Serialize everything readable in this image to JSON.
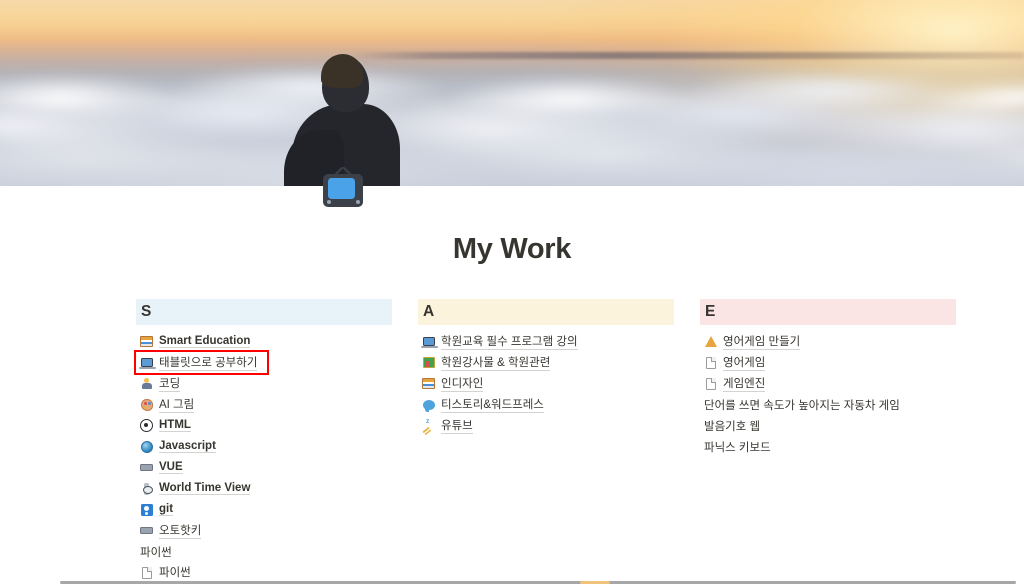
{
  "cover": {
    "alt": "sunset-above-clouds-with-person-silhouette",
    "name": "page-cover-image"
  },
  "page": {
    "icon": "television-icon",
    "title": "My Work"
  },
  "columns": [
    {
      "header": "S",
      "tone": "blue",
      "tone_color": "#e7f3f8",
      "items": [
        {
          "icon": "books-icon",
          "glyph": "g-books",
          "label": "Smart Education",
          "kind": "link",
          "korean": false,
          "highlighted": false
        },
        {
          "icon": "laptop-icon",
          "glyph": "g-laptop",
          "label": "태블릿으로 공부하기",
          "kind": "link",
          "korean": true,
          "highlighted": true
        },
        {
          "icon": "person-icon",
          "glyph": "g-person",
          "label": "코딩",
          "kind": "link",
          "korean": true,
          "highlighted": false
        },
        {
          "icon": "palette-icon",
          "glyph": "g-palette",
          "label": "AI 그림",
          "kind": "link",
          "korean": true,
          "highlighted": false
        },
        {
          "icon": "at-sign-icon",
          "glyph": "g-at",
          "label": "HTML",
          "kind": "link",
          "korean": false,
          "highlighted": false
        },
        {
          "icon": "globe-icon",
          "glyph": "g-js",
          "label": "Javascript",
          "kind": "link",
          "korean": false,
          "highlighted": false
        },
        {
          "icon": "keyboard-icon",
          "glyph": "g-keyboard",
          "label": "VUE",
          "kind": "link",
          "korean": false,
          "highlighted": false
        },
        {
          "icon": "watch-icon",
          "glyph": "g-watch",
          "label": "World Time View",
          "kind": "link",
          "korean": false,
          "highlighted": false
        },
        {
          "icon": "git-badge-icon",
          "glyph": "g-git",
          "label": "git",
          "kind": "link",
          "korean": false,
          "highlighted": false
        },
        {
          "icon": "keyboard-icon",
          "glyph": "g-keyboard",
          "label": "오토핫키",
          "kind": "link",
          "korean": true,
          "highlighted": false
        },
        {
          "icon": "",
          "glyph": "",
          "label": "파이썬",
          "kind": "plain",
          "korean": true,
          "highlighted": false
        },
        {
          "icon": "page-icon",
          "glyph": "g-page",
          "label": "파이썬",
          "kind": "link",
          "korean": true,
          "highlighted": false
        }
      ]
    },
    {
      "header": "A",
      "tone": "cream",
      "tone_color": "#fbf3db",
      "items": [
        {
          "icon": "laptop-icon",
          "glyph": "g-laptop",
          "label": "학원교육 필수 프로그램 강의",
          "kind": "link",
          "korean": true,
          "highlighted": false
        },
        {
          "icon": "framed-picture-icon",
          "glyph": "g-frame",
          "label": "학원강사물 & 학원관련",
          "kind": "link",
          "korean": true,
          "highlighted": false
        },
        {
          "icon": "books-icon",
          "glyph": "g-books",
          "label": "인디자인",
          "kind": "link",
          "korean": true,
          "highlighted": false
        },
        {
          "icon": "speech-balloon-icon",
          "glyph": "g-balloon",
          "label": "티스토리&워드프레스",
          "kind": "link",
          "korean": true,
          "highlighted": false
        },
        {
          "icon": "sleep-zzz-icon",
          "glyph": "g-zzz",
          "label": "유튜브",
          "kind": "link",
          "korean": true,
          "highlighted": false
        }
      ]
    },
    {
      "header": "E",
      "tone": "pink",
      "tone_color": "#fbe4e4",
      "items": [
        {
          "icon": "warning-triangle-icon",
          "glyph": "g-warn",
          "label": "영어게임 만들기",
          "kind": "link",
          "korean": true,
          "highlighted": false
        },
        {
          "icon": "page-icon",
          "glyph": "g-page",
          "label": "영어게임",
          "kind": "link",
          "korean": true,
          "highlighted": false
        },
        {
          "icon": "page-icon",
          "glyph": "g-page",
          "label": "게임엔진",
          "kind": "link",
          "korean": true,
          "highlighted": false
        },
        {
          "icon": "",
          "glyph": "",
          "label": "단어를 쓰면 속도가 높아지는 자동차 게임",
          "kind": "plain",
          "korean": true,
          "highlighted": false
        },
        {
          "icon": "",
          "glyph": "",
          "label": "발음기호 웹",
          "kind": "plain",
          "korean": true,
          "highlighted": false
        },
        {
          "icon": "",
          "glyph": "",
          "label": "파닉스 키보드",
          "kind": "plain",
          "korean": true,
          "highlighted": false
        }
      ]
    }
  ],
  "highlight": {
    "color": "#ff0000",
    "target": "태블릿으로 공부하기"
  },
  "scrollbar": {
    "name": "horizontal-scrollbar",
    "thumb_color": "#f0c27a"
  }
}
